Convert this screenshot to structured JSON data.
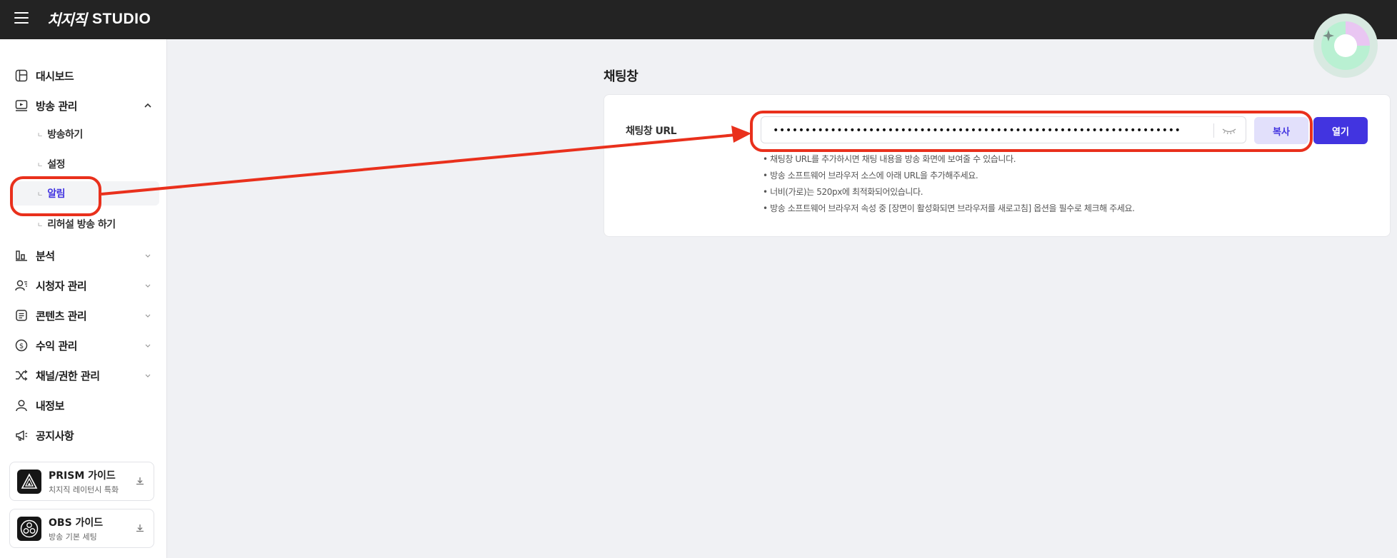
{
  "topbar": {
    "brand": "치지직",
    "studio": "STUDIO"
  },
  "sidebar": {
    "items": [
      {
        "label": "대시보드",
        "icon": "dashboard-icon"
      },
      {
        "label": "방송 관리",
        "icon": "broadcast-icon"
      },
      {
        "label": "분석",
        "icon": "analytics-icon"
      },
      {
        "label": "시청자 관리",
        "icon": "viewers-icon"
      },
      {
        "label": "콘텐츠 관리",
        "icon": "content-icon"
      },
      {
        "label": "수익 관리",
        "icon": "revenue-icon"
      },
      {
        "label": "채널/권한 관리",
        "icon": "shuffle-icon"
      },
      {
        "label": "내정보",
        "icon": "user-icon"
      },
      {
        "label": "공지사항",
        "icon": "megaphone-icon"
      }
    ],
    "sub_items": [
      {
        "label": "방송하기"
      },
      {
        "label": "설정"
      },
      {
        "label": "알림"
      },
      {
        "label": "리허설 방송 하기"
      }
    ],
    "guides": [
      {
        "title": "PRISM 가이드",
        "subtitle": "치지직 레이턴시 특화"
      },
      {
        "title": "OBS 가이드",
        "subtitle": "방송 기본 세팅"
      }
    ]
  },
  "main": {
    "section_title": "채팅창",
    "url_label": "채팅창 URL",
    "url_value": "••••••••••••••••••••••••••••••••••••••••••••••••••••••••••••••••",
    "copy_label": "복사",
    "open_label": "열기",
    "notes": [
      "• 채팅창 URL를 추가하시면 채팅 내용을 방송 화면에 보여줄 수 있습니다.",
      "• 방송 소프트웨어 브라우저 소스에 아래 URL을 추가해주세요.",
      "• 너비(가로)는 520px에 최적화되어있습니다.",
      "• 방송 소프트웨어 브라우저 속성 중 [장면이 활성화되면 브라우저를 새로고침] 옵션을 필수로 체크해 주세요."
    ]
  },
  "colors": {
    "accent": "#4234e0",
    "annotation": "#e9301c",
    "topbar": "#232323"
  }
}
